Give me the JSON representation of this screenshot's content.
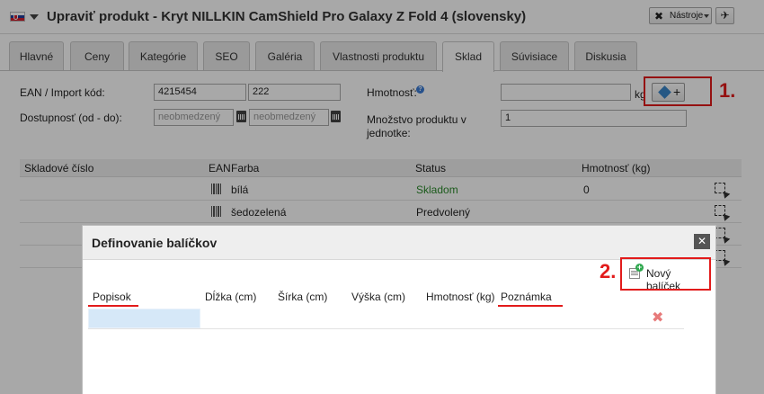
{
  "window": {
    "title": "Upraviť produkt - Kryt NILLKIN CamShield Pro Galaxy Z Fold 4 (slovensky)",
    "tools_label": "Nástroje",
    "flag_icon": "slovak-flag-icon"
  },
  "tabs": [
    {
      "label": "Hlavné"
    },
    {
      "label": "Ceny"
    },
    {
      "label": "Kategórie"
    },
    {
      "label": "SEO"
    },
    {
      "label": "Galéria"
    },
    {
      "label": "Vlastnosti produktu"
    },
    {
      "label": "Sklad",
      "active": true
    },
    {
      "label": "Súvisiace"
    },
    {
      "label": "Diskusia"
    }
  ],
  "form": {
    "ean_label": "EAN / Import kód:",
    "ean_value": "4215454",
    "import_code_value": "222",
    "availability_label": "Dostupnosť (od - do):",
    "availability_from_placeholder": "neobmedzený",
    "availability_to_placeholder": "neobmedzený",
    "weight_label": "Hmotnosť:",
    "weight_value": "",
    "weight_unit": "kg",
    "quantity_label_line1": "Množstvo produktu v",
    "quantity_label_line2": "jednotke:",
    "quantity_value": "1"
  },
  "stock_table": {
    "headers": {
      "sku": "Skladové číslo",
      "ean": "EAN",
      "color": "Farba",
      "status": "Status",
      "weight": "Hmotnosť (kg)"
    },
    "rows": [
      {
        "color": "bílá",
        "status": "Skladom",
        "weight": "0"
      },
      {
        "color": "šedozelená",
        "status": "Predvolený",
        "weight": ""
      }
    ]
  },
  "annotations": {
    "step1": "1.",
    "step2": "2.",
    "color": "#e21b1b"
  },
  "dialog": {
    "title": "Definovanie balíčkov",
    "new_button_label": "Nový balíček",
    "headers": {
      "description": "Popisok",
      "length": "Dĺžka (cm)",
      "width": "Šírka (cm)",
      "height": "Výška (cm)",
      "weight": "Hmotnosť (kg)",
      "note": "Poznámka"
    }
  }
}
